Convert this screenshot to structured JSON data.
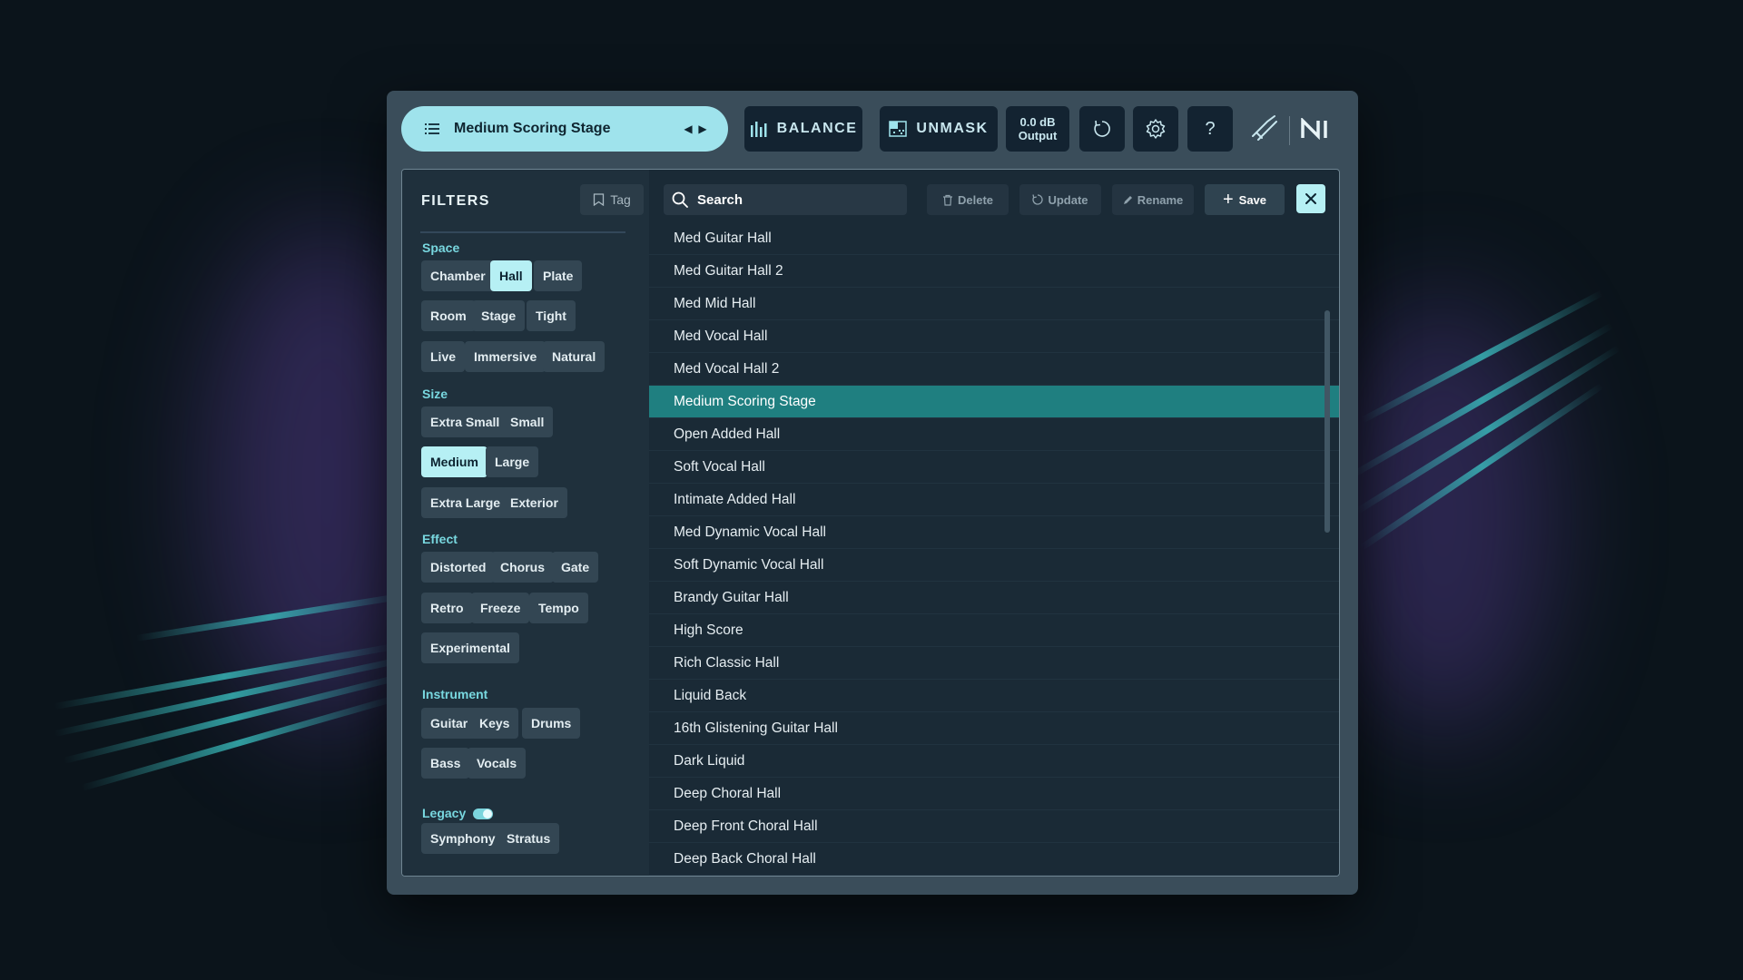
{
  "header": {
    "preset_name": "Medium Scoring Stage",
    "balance_label": "BALANCE",
    "unmask_label": "UNMASK",
    "output_value": "0.0 dB",
    "output_label": "Output",
    "help_label": "?"
  },
  "filters": {
    "title": "FILTERS",
    "tag_label": "Tag",
    "sections": {
      "space": {
        "label": "Space",
        "chips": [
          "Chamber",
          "Hall",
          "Plate",
          "Room",
          "Stage",
          "Tight",
          "Live",
          "Immersive",
          "Natural"
        ],
        "selected": "Hall"
      },
      "size": {
        "label": "Size",
        "chips": [
          "Extra Small",
          "Small",
          "Medium",
          "Large",
          "Extra Large",
          "Exterior"
        ],
        "selected": "Medium"
      },
      "effect": {
        "label": "Effect",
        "chips": [
          "Distorted",
          "Chorus",
          "Gate",
          "Retro",
          "Freeze",
          "Tempo",
          "Experimental"
        ]
      },
      "instrument": {
        "label": "Instrument",
        "chips": [
          "Guitar",
          "Keys",
          "Drums",
          "Bass",
          "Vocals"
        ]
      },
      "legacy": {
        "label": "Legacy",
        "toggle_on": true,
        "chips": [
          "Symphony",
          "Stratus"
        ]
      }
    }
  },
  "toolbar": {
    "search_placeholder": "Search",
    "delete_label": "Delete",
    "update_label": "Update",
    "rename_label": "Rename",
    "save_label": "Save"
  },
  "presets": [
    "Med Guitar Hall",
    "Med Guitar Hall 2",
    "Med Mid Hall",
    "Med Vocal Hall",
    "Med Vocal Hall 2",
    "Medium Scoring Stage",
    "Open Added Hall",
    "Soft Vocal Hall",
    "Intimate Added Hall",
    "Med Dynamic Vocal Hall",
    "Soft Dynamic Vocal Hall",
    "Brandy Guitar Hall",
    "High Score",
    "Rich Classic Hall",
    "Liquid Back",
    "16th Glistening Guitar Hall",
    "Dark Liquid",
    "Deep Choral Hall",
    "Deep Front Choral Hall",
    "Deep Back Choral Hall"
  ],
  "selected_preset": "Medium Scoring Stage",
  "colors": {
    "accent": "#9fe3ec",
    "selected_row": "#1f7f80",
    "section_label": "#78d7df"
  }
}
